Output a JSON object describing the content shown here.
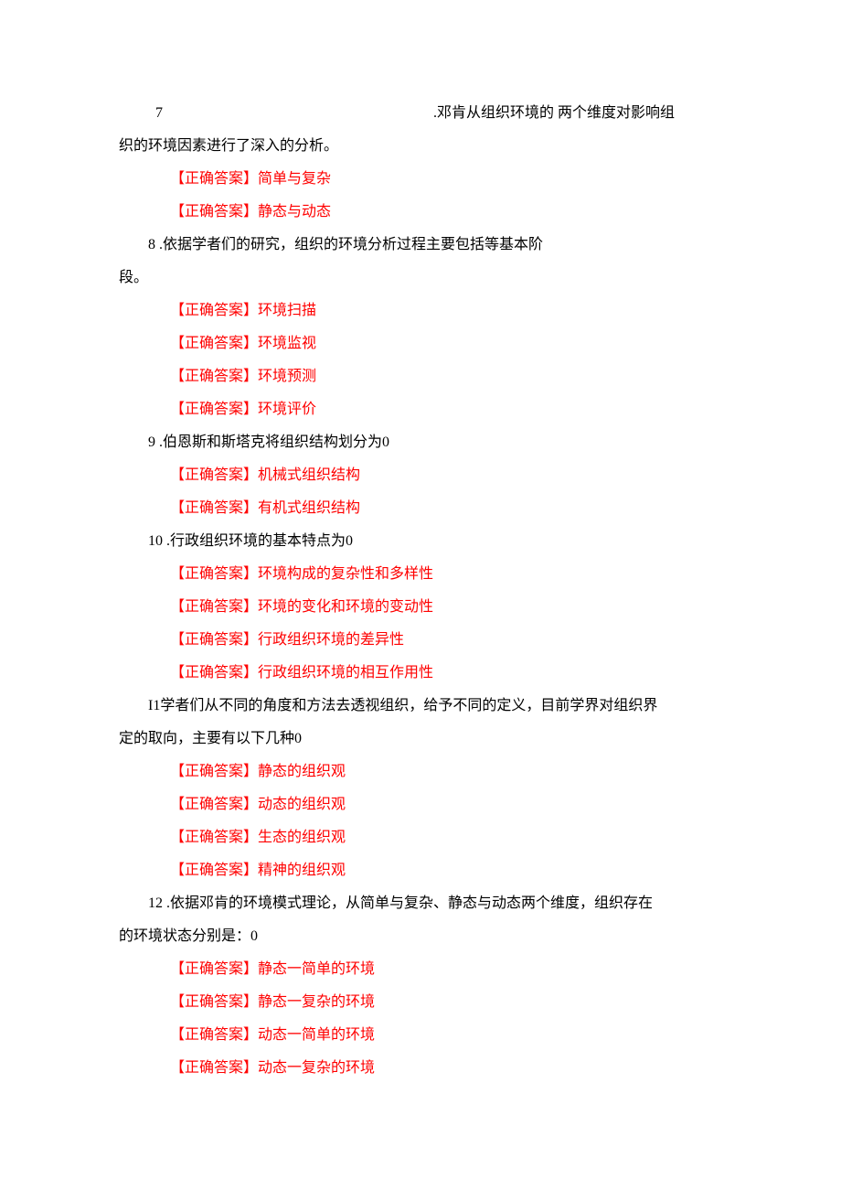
{
  "q7": {
    "num": "7",
    "line1_gap": "",
    "line1_after": ".邓肯从组织环境的 两个维度对影响组",
    "line2": "织的环境因素进行了深入的分析。",
    "answers": [
      "【正确答案】简单与复杂",
      "【正确答案】静态与动态"
    ]
  },
  "q8": {
    "text": "8 .依据学者们的研究，组织的环境分析过程主要包括等基本阶",
    "cont": "段。",
    "answers": [
      "【正确答案】环境扫描",
      "【正确答案】环境监视",
      "【正确答案】环境预测",
      "【正确答案】环境评价"
    ]
  },
  "q9": {
    "text": "9 .伯恩斯和斯塔克将组织结构划分为0",
    "answers": [
      "【正确答案】机械式组织结构",
      "【正确答案】有机式组织结构"
    ]
  },
  "q10": {
    "text": "10 .行政组织环境的基本特点为0",
    "answers": [
      "【正确答案】环境构成的复杂性和多样性",
      "【正确答案】环境的变化和环境的变动性",
      "【正确答案】行政组织环境的差异性",
      "【正确答案】行政组织环境的相互作用性"
    ]
  },
  "q11": {
    "text": "I1学者们从不同的角度和方法去透视组织，给予不同的定义，目前学界对组织界",
    "cont": "定的取向，主要有以下几种0",
    "answers": [
      "【正确答案】静态的组织观",
      "【正确答案】动态的组织观",
      "【正确答案】生态的组织观",
      "【正确答案】精神的组织观"
    ]
  },
  "q12": {
    "text": "12 .依据邓肯的环境模式理论，从简单与复杂、静态与动态两个维度，组织存在",
    "cont": "的环境状态分别是：0",
    "answers": [
      "【正确答案】静态一简单的环境",
      "【正确答案】静态一复杂的环境",
      "【正确答案】动态一简单的环境",
      "【正确答案】动态一复杂的环境"
    ]
  }
}
